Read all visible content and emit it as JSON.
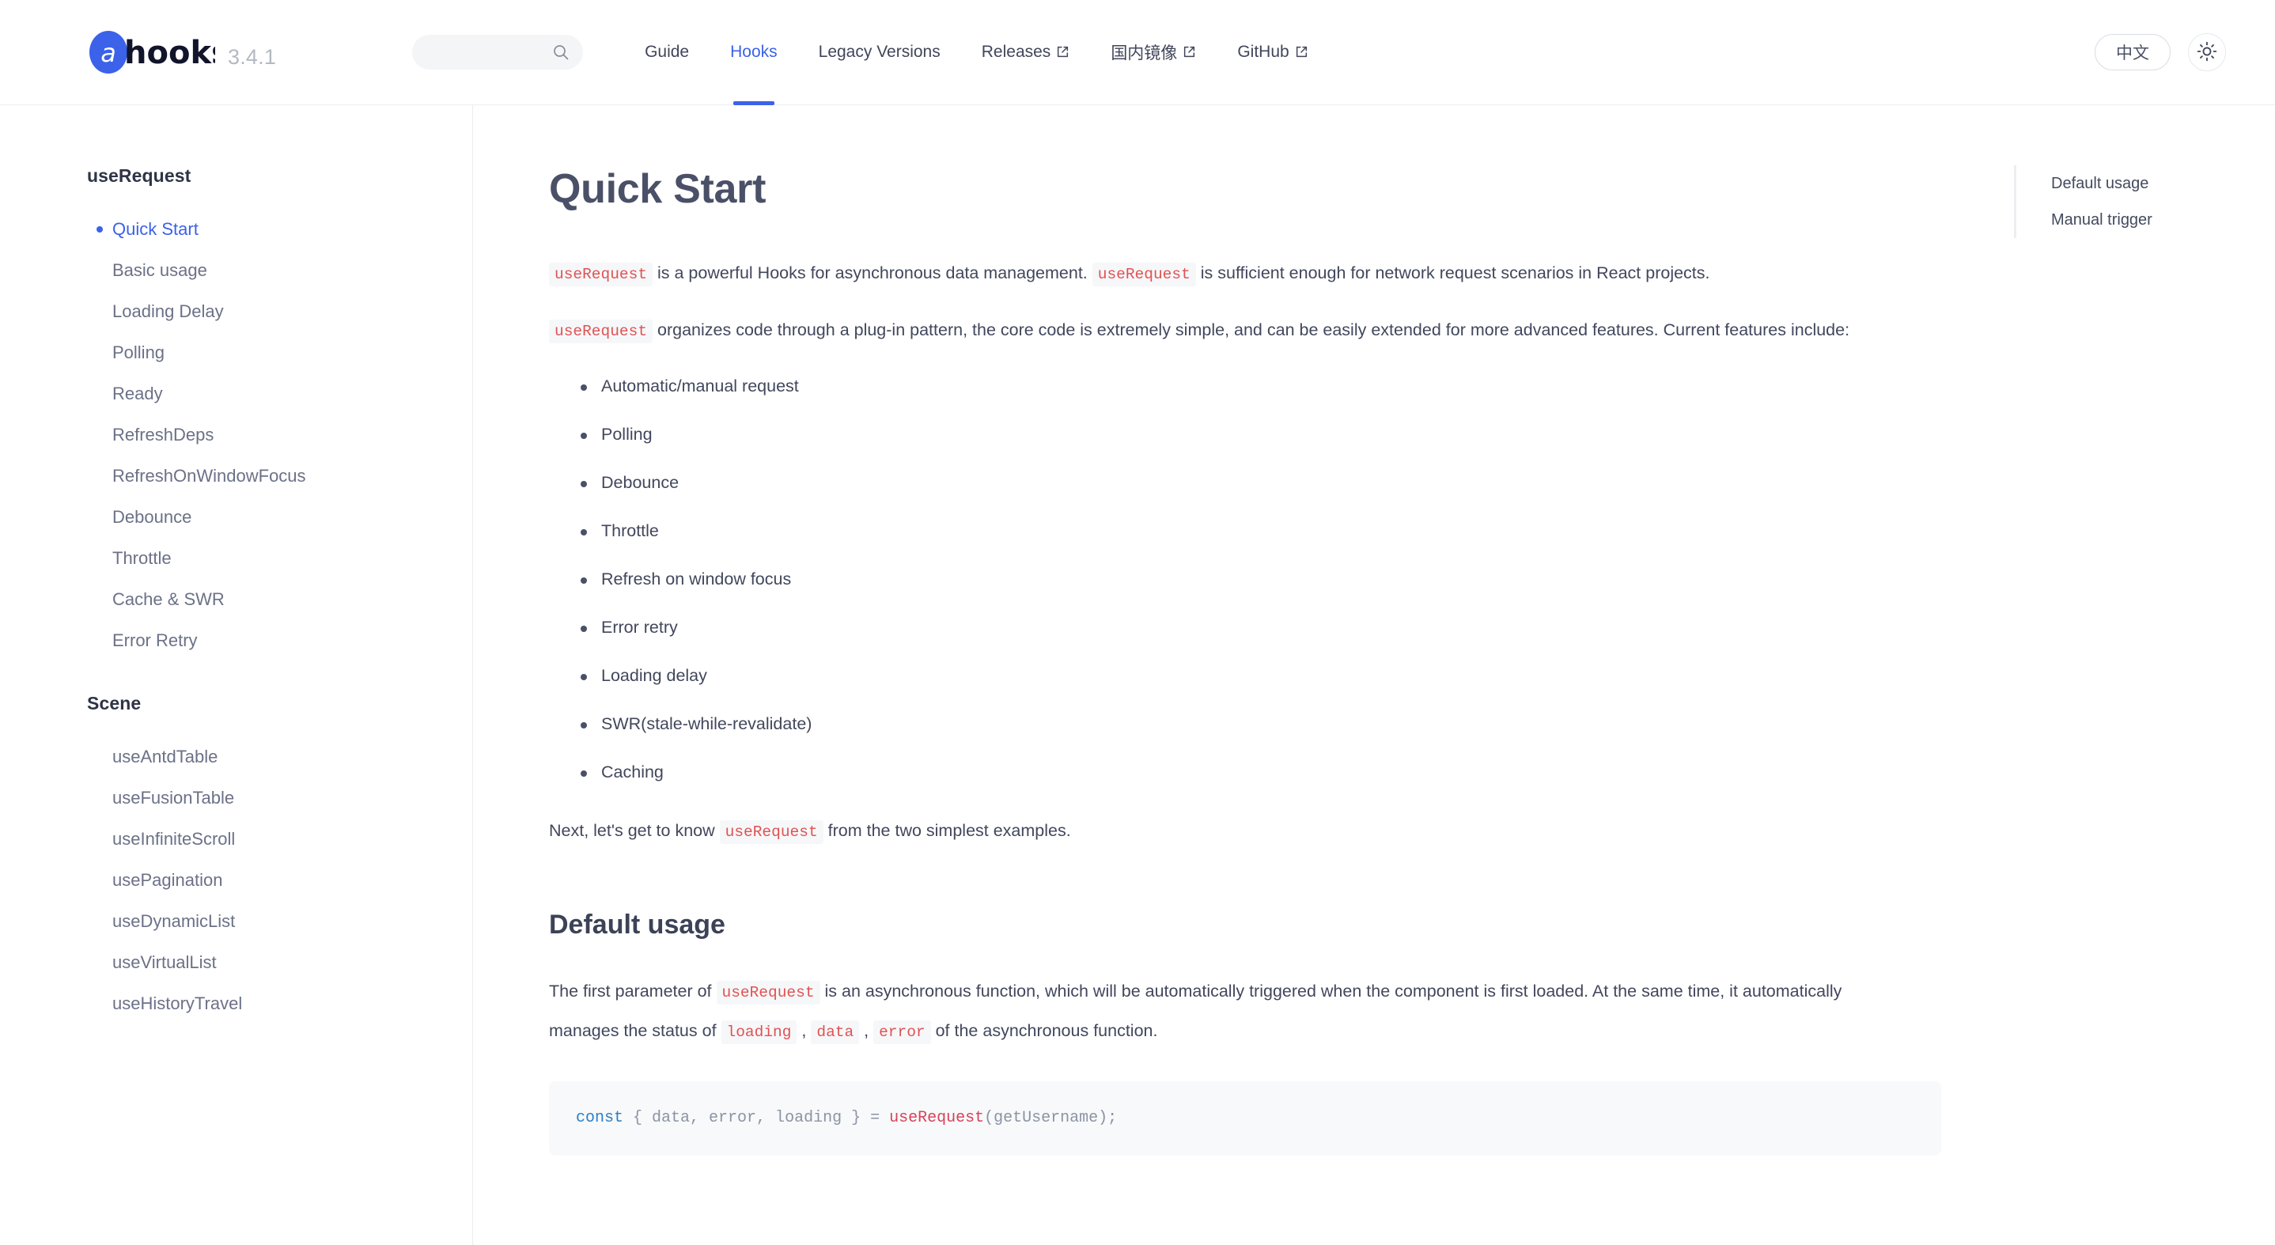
{
  "header": {
    "brand_name": "hooks",
    "brand_mark_letter": "a",
    "version": "3.4.1",
    "search": {
      "value": "",
      "placeholder": "",
      "icon": "search-icon"
    },
    "nav": [
      {
        "label": "Guide",
        "active": false,
        "external": false
      },
      {
        "label": "Hooks",
        "active": true,
        "external": false
      },
      {
        "label": "Legacy Versions",
        "active": false,
        "external": false
      },
      {
        "label": "Releases",
        "active": false,
        "external": true
      },
      {
        "label": "国内镜像",
        "active": false,
        "external": true
      },
      {
        "label": "GitHub",
        "active": false,
        "external": true
      }
    ],
    "language_button": "中文",
    "theme_toggle_icon": "sun-icon",
    "accent_color": "#3b62e8"
  },
  "sidebar": {
    "groups": [
      {
        "title": "useRequest",
        "items": [
          {
            "label": "Quick Start",
            "active": true
          },
          {
            "label": "Basic usage",
            "active": false
          },
          {
            "label": "Loading Delay",
            "active": false
          },
          {
            "label": "Polling",
            "active": false
          },
          {
            "label": "Ready",
            "active": false
          },
          {
            "label": "RefreshDeps",
            "active": false
          },
          {
            "label": "RefreshOnWindowFocus",
            "active": false
          },
          {
            "label": "Debounce",
            "active": false
          },
          {
            "label": "Throttle",
            "active": false
          },
          {
            "label": "Cache & SWR",
            "active": false
          },
          {
            "label": "Error Retry",
            "active": false
          }
        ]
      },
      {
        "title": "Scene",
        "items": [
          {
            "label": "useAntdTable",
            "active": false
          },
          {
            "label": "useFusionTable",
            "active": false
          },
          {
            "label": "useInfiniteScroll",
            "active": false
          },
          {
            "label": "usePagination",
            "active": false
          },
          {
            "label": "useDynamicList",
            "active": false
          },
          {
            "label": "useVirtualList",
            "active": false
          },
          {
            "label": "useHistoryTravel",
            "active": false
          }
        ]
      }
    ]
  },
  "main": {
    "page_title": "Quick Start",
    "para1": {
      "code1": "useRequest",
      "text1": " is a powerful Hooks for asynchronous data management. ",
      "code2": "useRequest",
      "text2": " is sufficient enough for network request scenarios in React projects."
    },
    "para2": {
      "code1": "useRequest",
      "text1": " organizes code through a plug-in pattern, the core code is extremely simple, and can be easily extended for more advanced features. Current features include:"
    },
    "features": [
      "Automatic/manual request",
      "Polling",
      "Debounce",
      "Throttle",
      "Refresh on window focus",
      "Error retry",
      "Loading delay",
      "SWR(stale-while-revalidate)",
      "Caching"
    ],
    "para3": {
      "text1": "Next, let's get to know ",
      "code1": "useRequest",
      "text2": " from the two simplest examples."
    },
    "section_title": "Default usage",
    "para4": {
      "text1": "The first parameter of ",
      "code1": "useRequest",
      "text2": " is an asynchronous function, which will be automatically triggered when the component is first loaded. At the same time, it automatically manages the status of ",
      "code2": "loading",
      "sep1": " , ",
      "code3": "data",
      "sep2": " , ",
      "code4": "error",
      "text3": " of the asynchronous function."
    },
    "code_sample": {
      "kw1": "const",
      "destructure": "{ data, error, loading }",
      "eq": "=",
      "fn": "useRequest",
      "args": "(getUsername);"
    }
  },
  "toc": {
    "items": [
      {
        "label": "Default usage"
      },
      {
        "label": "Manual trigger"
      }
    ]
  }
}
